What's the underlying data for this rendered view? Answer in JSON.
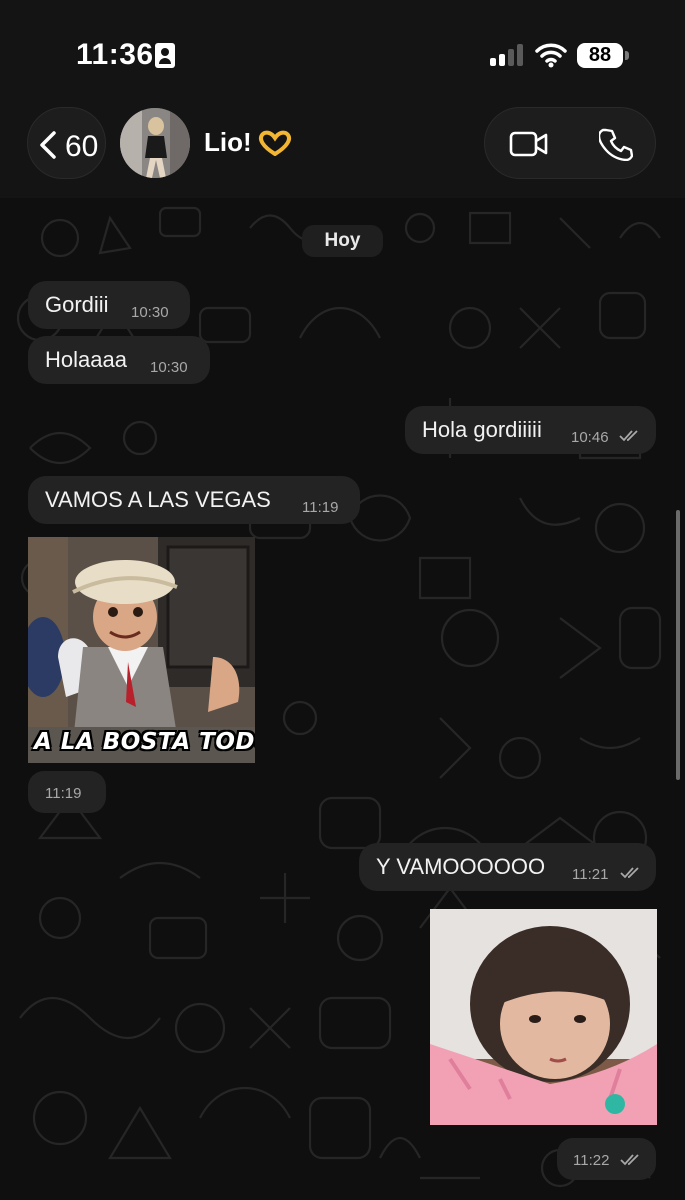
{
  "status_bar": {
    "time": "11:36",
    "battery": "88"
  },
  "header": {
    "back_count": "60",
    "contact_name": "Lio!",
    "name_emoji": "heart-hands-icon"
  },
  "chat": {
    "date_label": "Hoy",
    "messages": [
      {
        "dir": "in",
        "type": "text",
        "text": "Gordiii",
        "time": "10:30"
      },
      {
        "dir": "in",
        "type": "text",
        "text": "Holaaaa",
        "time": "10:30"
      },
      {
        "dir": "out",
        "type": "text",
        "text": "Hola gordiiiii",
        "time": "10:46",
        "status": "read"
      },
      {
        "dir": "in",
        "type": "text",
        "text": "VAMOS A LAS VEGAS",
        "time": "11:19"
      },
      {
        "dir": "in",
        "type": "sticker",
        "caption": "A LA BOSTA TODO..",
        "time": "11:19"
      },
      {
        "dir": "out",
        "type": "text",
        "text": "Y VAMOOOOOO",
        "time": "11:21",
        "status": "read"
      },
      {
        "dir": "out",
        "type": "sticker",
        "time": "11:22",
        "status": "read"
      }
    ]
  },
  "colors": {
    "background": "#0b0b0b",
    "bubble": "#232323",
    "header": "#141414",
    "tick_read": "#a8a8a8"
  }
}
